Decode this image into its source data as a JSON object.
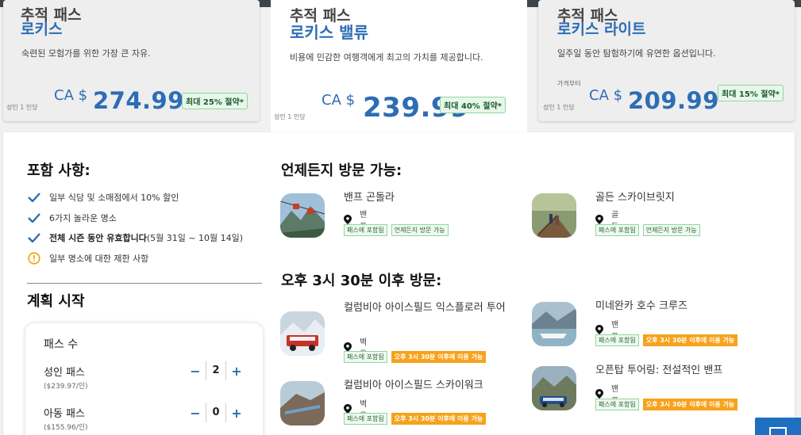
{
  "cards": [
    {
      "pre": "추적 패스",
      "name": "로키스",
      "desc": "숙련된 모험가를 위한 가장 큰 자유.",
      "from": "",
      "currency": "CA $",
      "price": "274.99",
      "save": "최대 25% 절약*",
      "per": "성인 1 인당"
    },
    {
      "pre": "추적 패스",
      "name": "로키스 밸류",
      "desc": "비용에 민감한 여행객에게 최고의 가치를 제공합니다.",
      "from": "",
      "currency": "CA $",
      "price": "239.99",
      "save": "최대 40% 절약*",
      "per": "성인 1 인당"
    },
    {
      "pre": "추적 패스",
      "name": "로키스 라이트",
      "desc": "일주일 동안 탐험하기에 유연한 옵션입니다.",
      "from": "가격부터",
      "currency": "CA $",
      "price": "209.99",
      "save": "최대 15% 절약*",
      "per": "성인 1 인당"
    }
  ],
  "included": {
    "heading": "포함 사항:",
    "items": [
      {
        "icon": "check-icon",
        "text": "일부 식당 및 소매점에서 10% 할인",
        "bold": ""
      },
      {
        "icon": "check-icon",
        "text": "6가지 놀라운 명소",
        "bold": ""
      },
      {
        "icon": "check-icon",
        "text": " (5월 31일 ~ 10월 14일)",
        "bold": "전체 시즌 동안 유효합니다"
      },
      {
        "icon": "alert-icon",
        "text": "일부 명소에 대한 제한 사항",
        "bold": ""
      }
    ]
  },
  "plan": {
    "heading": "계획 시작",
    "box_title": "패스 수",
    "adult_label": "성인 패스",
    "adult_price": "($239.97/인)",
    "adult_count": "2",
    "child_label": "아동 패스",
    "child_price": "($155.96/인)",
    "child_count": "0",
    "minus": "−",
    "plus": "+"
  },
  "anytime": {
    "heading": "언제든지 방문 가능:",
    "items": [
      {
        "name": "밴프 곤돌라",
        "location": "밴프",
        "tags": [
          "패스에 포함됨",
          "언제든지 방문 가능"
        ]
      },
      {
        "name": "골든 스카이브릿지",
        "location": "골든",
        "tags": [
          "패스에 포함됨",
          "언제든지 방문 가능"
        ]
      }
    ]
  },
  "after": {
    "heading": "오후 3시 30분 이후 방문:",
    "items": [
      {
        "name": "컬럼비아 아이스필드 익스플로러 투어",
        "location": "벽옥",
        "tags": [
          "패스에 포함됨",
          "오후 3시 30분 이후에 이용 가능"
        ]
      },
      {
        "name": "미네완카 호수 크루즈",
        "location": "밴프",
        "tags": [
          "패스에 포함됨",
          "오후 3시 30분 이후에 이용 가능"
        ]
      },
      {
        "name": "컬럼비아 아이스필드 스카이워크",
        "location": "벽옥",
        "tags": [
          "패스에 포함됨",
          "오후 3시 30분 이후에 이용 가능"
        ]
      },
      {
        "name": "오픈탑 투어링: 전설적인 밴프",
        "location": "밴프",
        "tags": [
          "패스에 포함됨",
          "오후 3시 30분 이후에 이용 가능"
        ]
      }
    ]
  },
  "colors": {
    "accent": "#2d6db5",
    "success_bg": "#e7f7ea",
    "orange": "#f7a21b"
  }
}
